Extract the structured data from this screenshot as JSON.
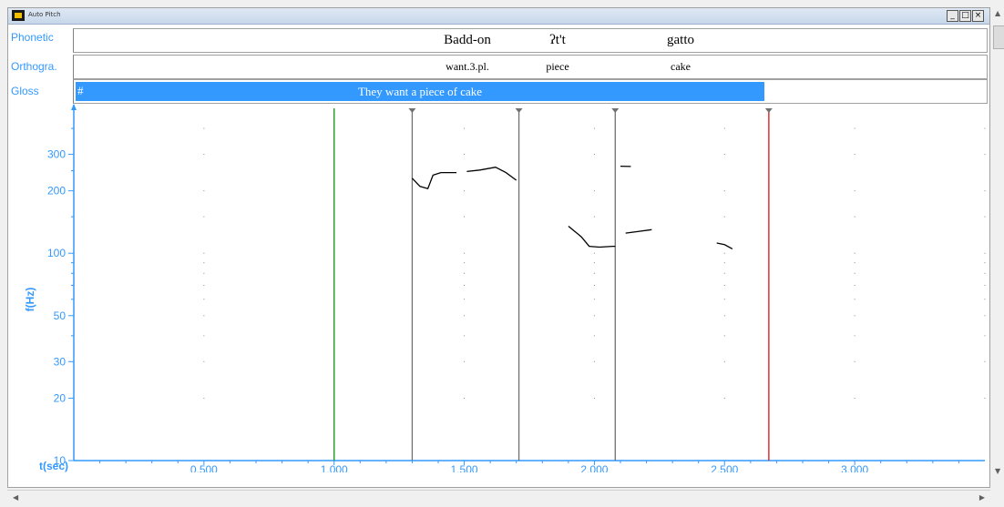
{
  "window": {
    "title": "Auto Pitch",
    "minimize": "_",
    "restore": "□",
    "close": "×"
  },
  "tiers": {
    "phonetic": {
      "label": "Phonetic",
      "segments": [
        "Badd-on",
        "ʔt't",
        "gatto"
      ]
    },
    "orthographic": {
      "label": "Orthogra.",
      "segments": [
        "want.3.pl.",
        "piece",
        "cake"
      ]
    },
    "gloss": {
      "label": "Gloss",
      "marker": "#",
      "text": "They want a piece of cake"
    }
  },
  "colors": {
    "accent": "#3399ff",
    "green_cursor": "#2aa12a",
    "red_cursor": "#e0302e",
    "boundary": "#707070",
    "pitch": "#000000"
  },
  "chart_data": {
    "type": "line",
    "ylabel": "f(Hz)",
    "xlabel": "t(sec)",
    "yscale": "log",
    "ylim": [
      10,
      500
    ],
    "xlim": [
      0.0,
      3.5
    ],
    "y_ticks": [
      "10",
      "20",
      "30",
      "50",
      "100",
      "200",
      "300"
    ],
    "x_ticks": [
      "0.500",
      "1.000",
      "1.500",
      "2.000",
      "2.500",
      "3.000"
    ],
    "cursors": {
      "start": 1.0,
      "end": 2.67
    },
    "boundaries": [
      1.3,
      1.71,
      2.08
    ],
    "series": [
      {
        "x": [
          1.3,
          1.33,
          1.36,
          1.38,
          1.41,
          1.45,
          1.47
        ],
        "y": [
          230,
          210,
          205,
          238,
          245,
          245,
          245
        ]
      },
      {
        "x": [
          1.51,
          1.56,
          1.62,
          1.66,
          1.7
        ],
        "y": [
          248,
          252,
          260,
          245,
          225
        ]
      },
      {
        "x": [
          1.9,
          1.95,
          1.98,
          2.02,
          2.07,
          2.08
        ],
        "y": [
          135,
          120,
          108,
          107,
          108,
          108
        ]
      },
      {
        "x": [
          2.12,
          2.16,
          2.22
        ],
        "y": [
          125,
          127,
          130
        ]
      },
      {
        "x": [
          2.1,
          2.14
        ],
        "y": [
          263,
          262
        ]
      },
      {
        "x": [
          2.47,
          2.5,
          2.53
        ],
        "y": [
          112,
          110,
          105
        ]
      }
    ]
  }
}
